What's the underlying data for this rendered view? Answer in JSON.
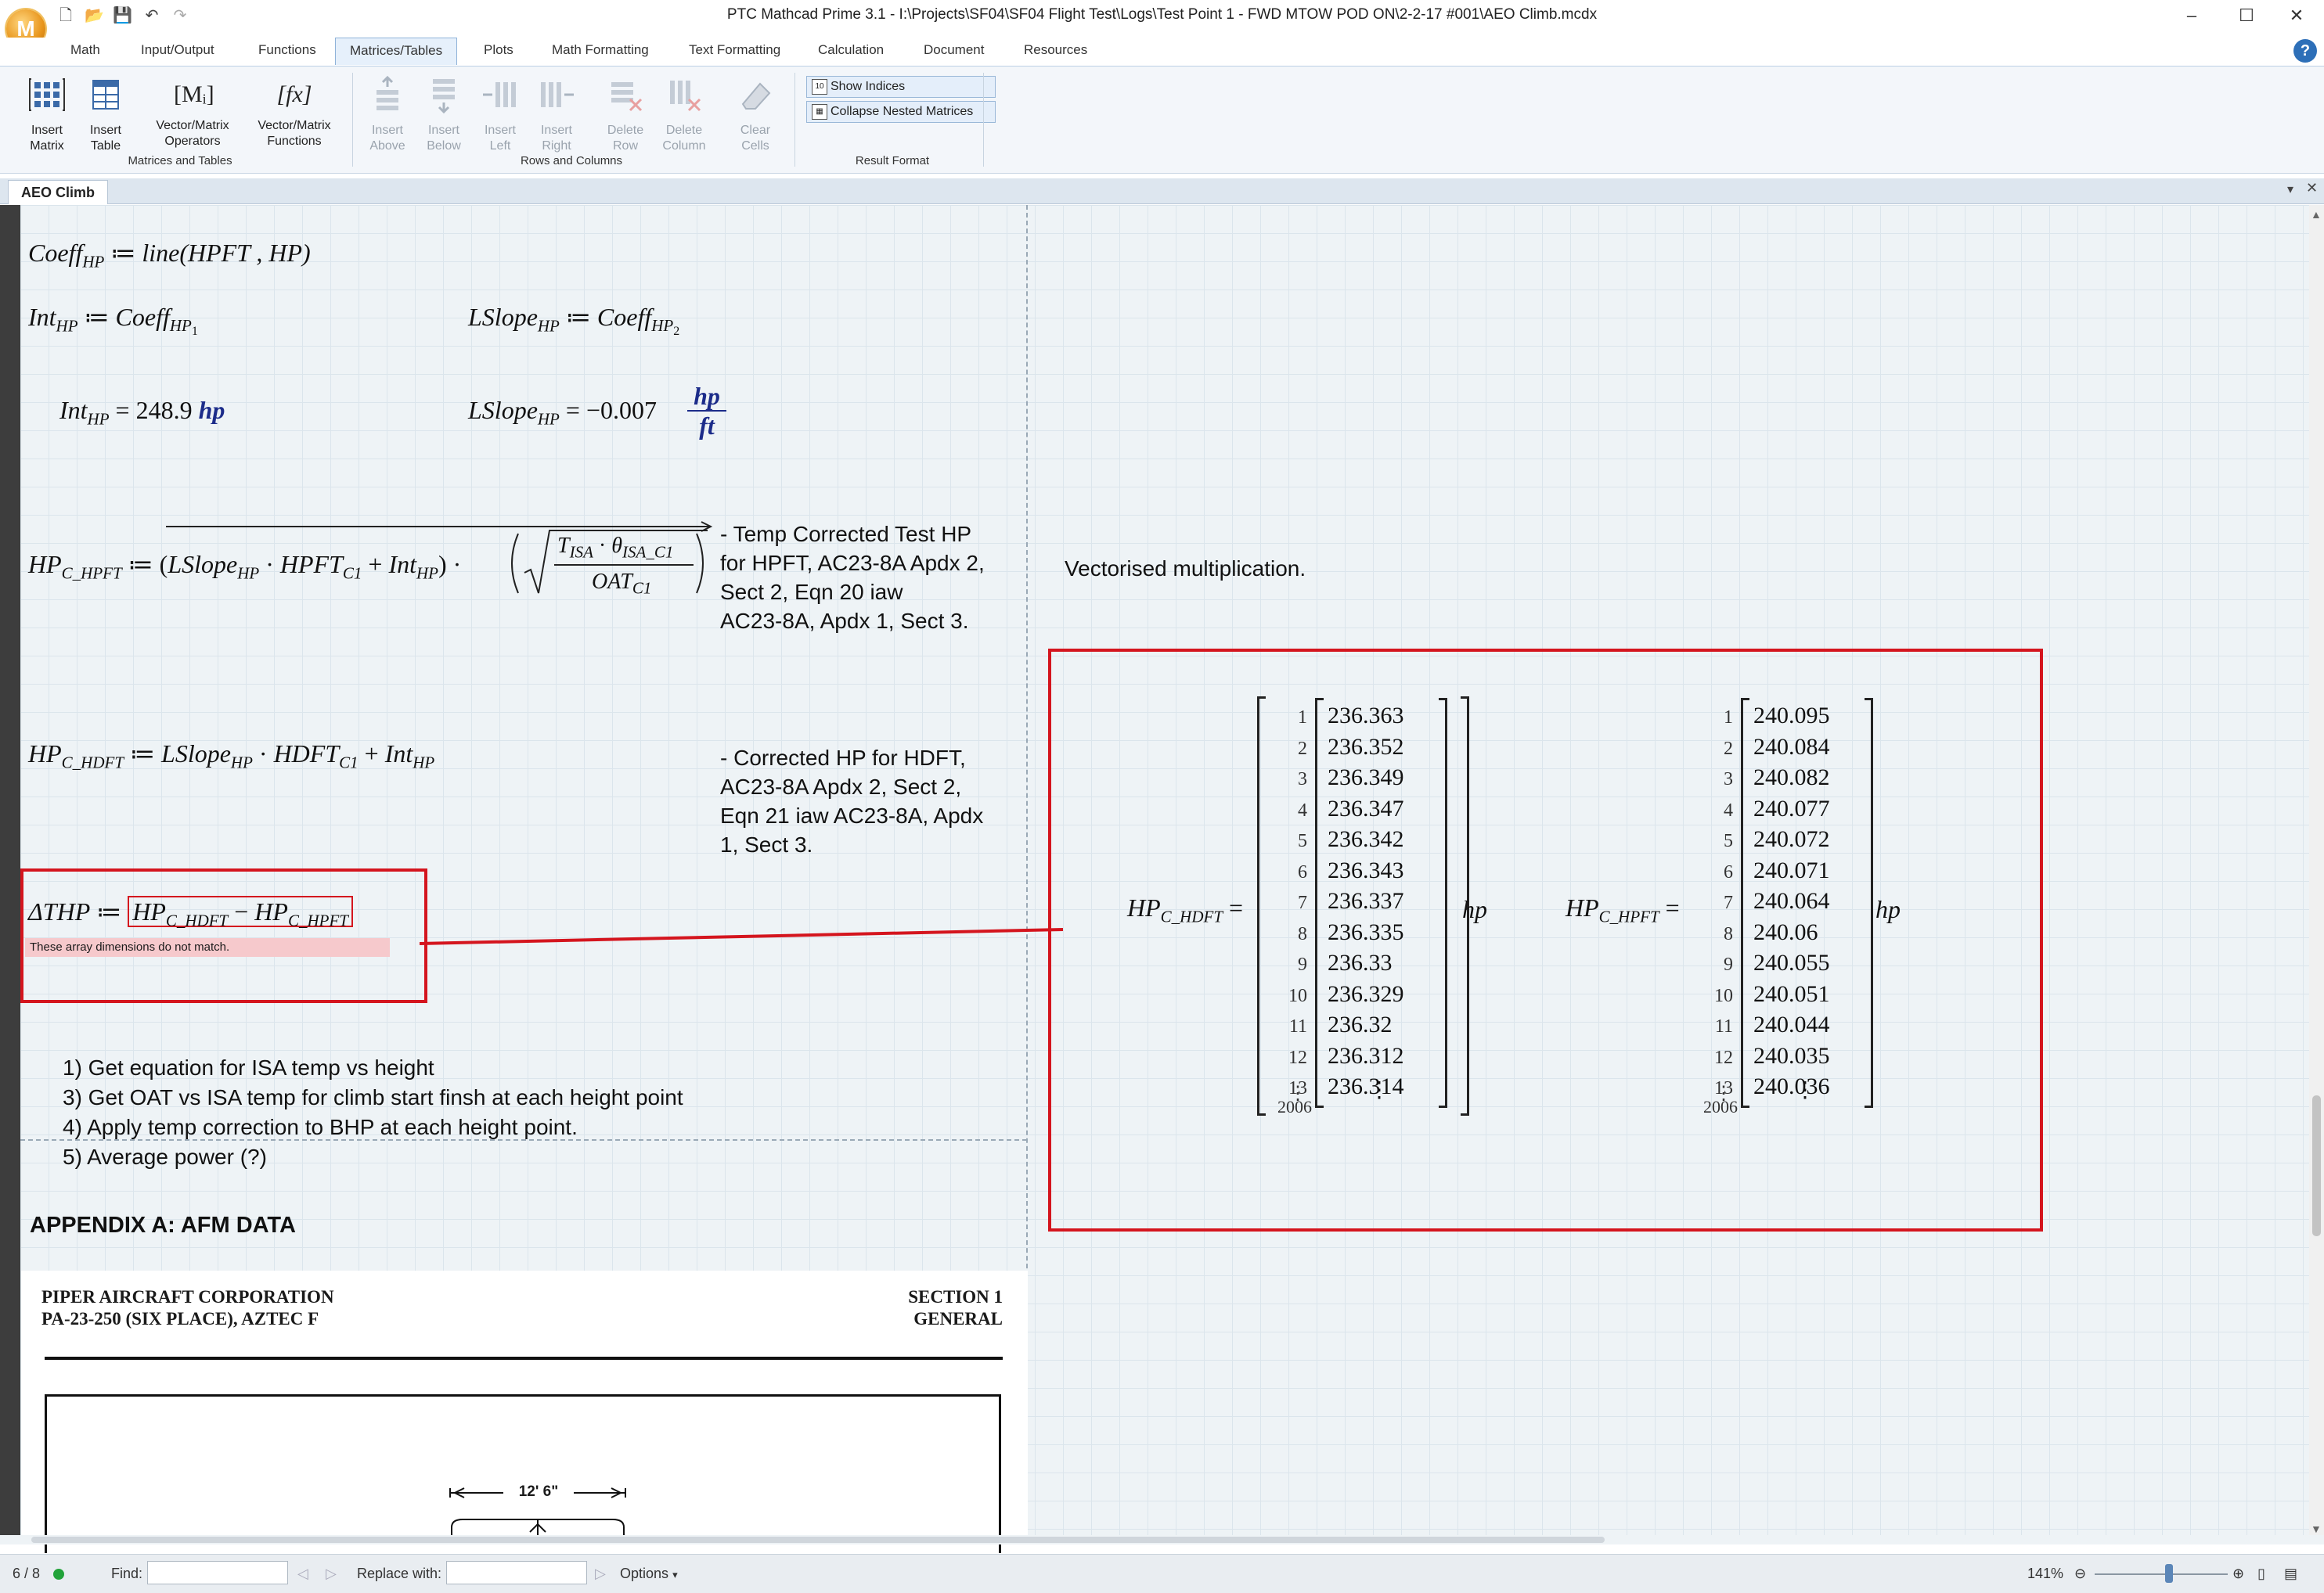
{
  "window": {
    "title": "PTC Mathcad Prime 3.1 - I:\\Projects\\SF04\\SF04 Flight Test\\Logs\\Test Point 1 - FWD MTOW POD ON\\2-2-17 #001\\AEO Climb.mcdx",
    "logo_letter": "M"
  },
  "tabs": [
    "Math",
    "Input/Output",
    "Functions",
    "Matrices/Tables",
    "Plots",
    "Math Formatting",
    "Text Formatting",
    "Calculation",
    "Document",
    "Resources"
  ],
  "help": "?",
  "ribbon": {
    "insert_matrix": "Insert\nMatrix",
    "insert_table": "Insert\nTable",
    "vm_operators": "Vector/Matrix\nOperators",
    "vm_functions": "Vector/Matrix\nFunctions",
    "insert_above": "Insert\nAbove",
    "insert_below": "Insert\nBelow",
    "insert_left": "Insert\nLeft",
    "insert_right": "Insert\nRight",
    "delete_row": "Delete\nRow",
    "delete_column": "Delete\nColumn",
    "clear_cells": "Clear\nCells",
    "show_indices": "Show Indices",
    "collapse_nested": "Collapse Nested Matrices",
    "group_matrices": "Matrices and Tables",
    "group_rows": "Rows and Columns",
    "group_result": "Result Format",
    "icon_mi": "[Mᵢ]",
    "icon_fx": "[fx]"
  },
  "doc_tab": "AEO Climb",
  "worksheet": {
    "coeff_def": "line",
    "coeff_args": "(HPFT , HP)",
    "int_result_value": "248.9",
    "int_result_unit": "hp",
    "lslope_result_value": "−0.007",
    "lslope_unit_num": "hp",
    "lslope_unit_den": "ft",
    "note_hpft": "- Temp Corrected Test HP\nfor HPFT, AC23-8A Apdx 2,\nSect 2, Eqn 20 iaw\nAC23-8A, Apdx 1, Sect 3.",
    "note_hdft": "- Corrected HP for HDFT,\nAC23-8A Apdx 2, Sect 2,\nEqn 21 iaw AC23-8A, Apdx\n1, Sect 3.",
    "vectorised": "Vectorised multiplication.",
    "error_msg": "These array dimensions do not match.",
    "todo": [
      "1) Get equation for ISA temp vs height",
      "3) Get OAT vs ISA temp for climb start finsh at each height point",
      "4) Apply temp correction to BHP at each height point.",
      "5) Average power (?)"
    ],
    "appendix": "APPENDIX A: AFM DATA",
    "afm_left1": "PIPER AIRCRAFT CORPORATION",
    "afm_left2": "PA-23-250 (SIX PLACE), AZTEC F",
    "afm_right1": "SECTION 1",
    "afm_right2": "GENERAL",
    "afm_dim": "12' 6\""
  },
  "matrix_hdft": {
    "indices": [
      "1",
      "2",
      "3",
      "4",
      "5",
      "6",
      "7",
      "8",
      "9",
      "10",
      "11",
      "12",
      "13"
    ],
    "values": [
      "236.363",
      "236.352",
      "236.349",
      "236.347",
      "236.342",
      "236.343",
      "236.337",
      "236.335",
      "236.33",
      "236.329",
      "236.32",
      "236.312",
      "236.314"
    ],
    "size": "2006",
    "unit": "hp"
  },
  "matrix_hpft": {
    "indices": [
      "1",
      "2",
      "3",
      "4",
      "5",
      "6",
      "7",
      "8",
      "9",
      "10",
      "11",
      "12",
      "13"
    ],
    "values": [
      "240.095",
      "240.084",
      "240.082",
      "240.077",
      "240.072",
      "240.071",
      "240.064",
      "240.06",
      "240.055",
      "240.051",
      "240.044",
      "240.035",
      "240.036"
    ],
    "size": "2006",
    "unit": "hp"
  },
  "status": {
    "page": "6 / 8",
    "find_label": "Find:",
    "replace_label": "Replace with:",
    "options": "Options",
    "zoom": "141%"
  }
}
